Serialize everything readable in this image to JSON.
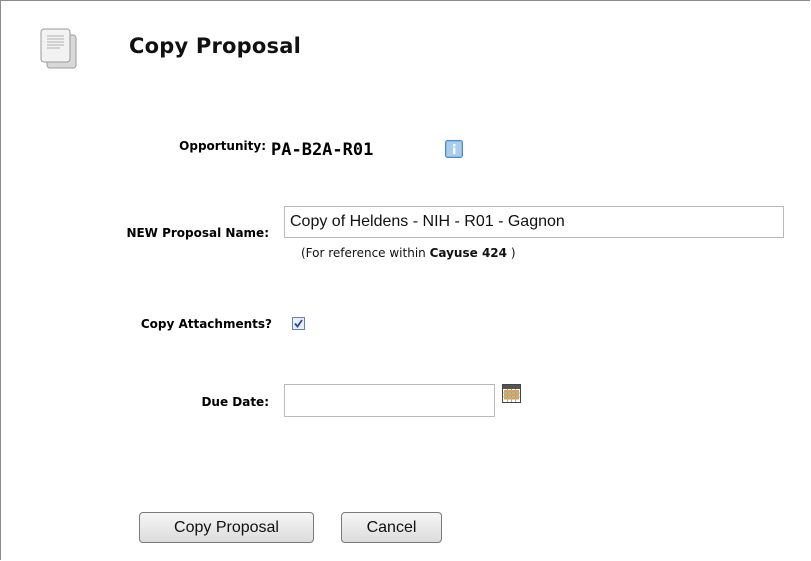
{
  "header": {
    "title": "Copy Proposal",
    "icon": "document-copy-icon"
  },
  "form": {
    "opportunity": {
      "label": "Opportunity:",
      "value": "PA-B2A-R01",
      "info_icon": "info-icon",
      "info_color": "#5b9bd5"
    },
    "proposal_name": {
      "label": "NEW Proposal Name:",
      "value": "Copy of Heldens - NIH - R01 - Gagnon",
      "hint_prefix": "(For reference within ",
      "hint_bold": "Cayuse 424",
      "hint_suffix": " )"
    },
    "copy_attachments": {
      "label": "Copy Attachments?",
      "checked": true
    },
    "due_date": {
      "label": "Due Date:",
      "value": "",
      "calendar_icon": "calendar-icon"
    }
  },
  "actions": {
    "copy_label": "Copy Proposal",
    "cancel_label": "Cancel"
  }
}
